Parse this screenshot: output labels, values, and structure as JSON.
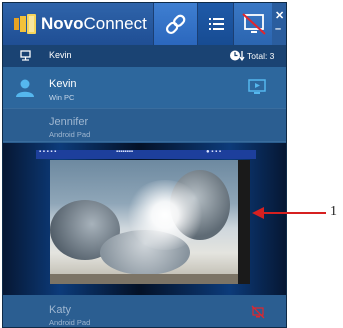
{
  "header": {
    "brand_part1": "Novo",
    "brand_part2": "Connect",
    "icons": [
      "logo-icon",
      "link-icon",
      "list-icon",
      "mirror-off-icon",
      "close-icon",
      "minimize-icon"
    ]
  },
  "status_bar": {
    "presenter": "Kevin",
    "total": "Total: 3",
    "icons": [
      "present-icon",
      "clock-sort-icon"
    ]
  },
  "participants": [
    {
      "name": "Kevin",
      "device": "Win PC",
      "icon": "user-icon",
      "status_icon": "screen-play-icon"
    },
    {
      "name": "Jennifer",
      "device": "Android Pad"
    },
    {
      "name": "Katy",
      "device": "Android Pad",
      "status_icon": "screen-off-icon"
    }
  ],
  "annotation": {
    "label": "1",
    "color": "#d62020"
  },
  "colors": {
    "panel": "#2a5d8f",
    "header": "#2558a2",
    "status_bar": "#1a4373",
    "accent_red": "#d62020"
  }
}
